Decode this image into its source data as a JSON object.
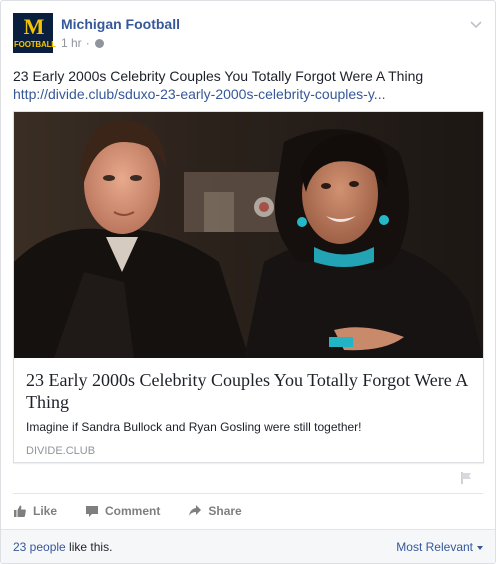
{
  "header": {
    "avatar_letter": "M",
    "avatar_sub": "FOOTBALL",
    "page_name": "Michigan Football",
    "time": "1 hr",
    "separator": "·"
  },
  "post": {
    "text": "23 Early 2000s Celebrity Couples You Totally Forgot Were A Thing",
    "link": "http://divide.club/sduxo-23-early-2000s-celebrity-couples-y..."
  },
  "preview": {
    "title": "23 Early 2000s Celebrity Couples You Totally Forgot Were A Thing",
    "description": "Imagine if Sandra Bullock and Ryan Gosling were still together!",
    "domain": "DIVIDE.CLUB"
  },
  "actions": {
    "like": "Like",
    "comment": "Comment",
    "share": "Share"
  },
  "footer": {
    "likes_count": "23 people",
    "likes_suffix": " like this.",
    "sort_label": "Most Relevant"
  },
  "colors": {
    "link_blue": "#365899",
    "muted": "#90949c",
    "brand_navy": "#0a1f3d",
    "brand_maize": "#f5c400"
  }
}
